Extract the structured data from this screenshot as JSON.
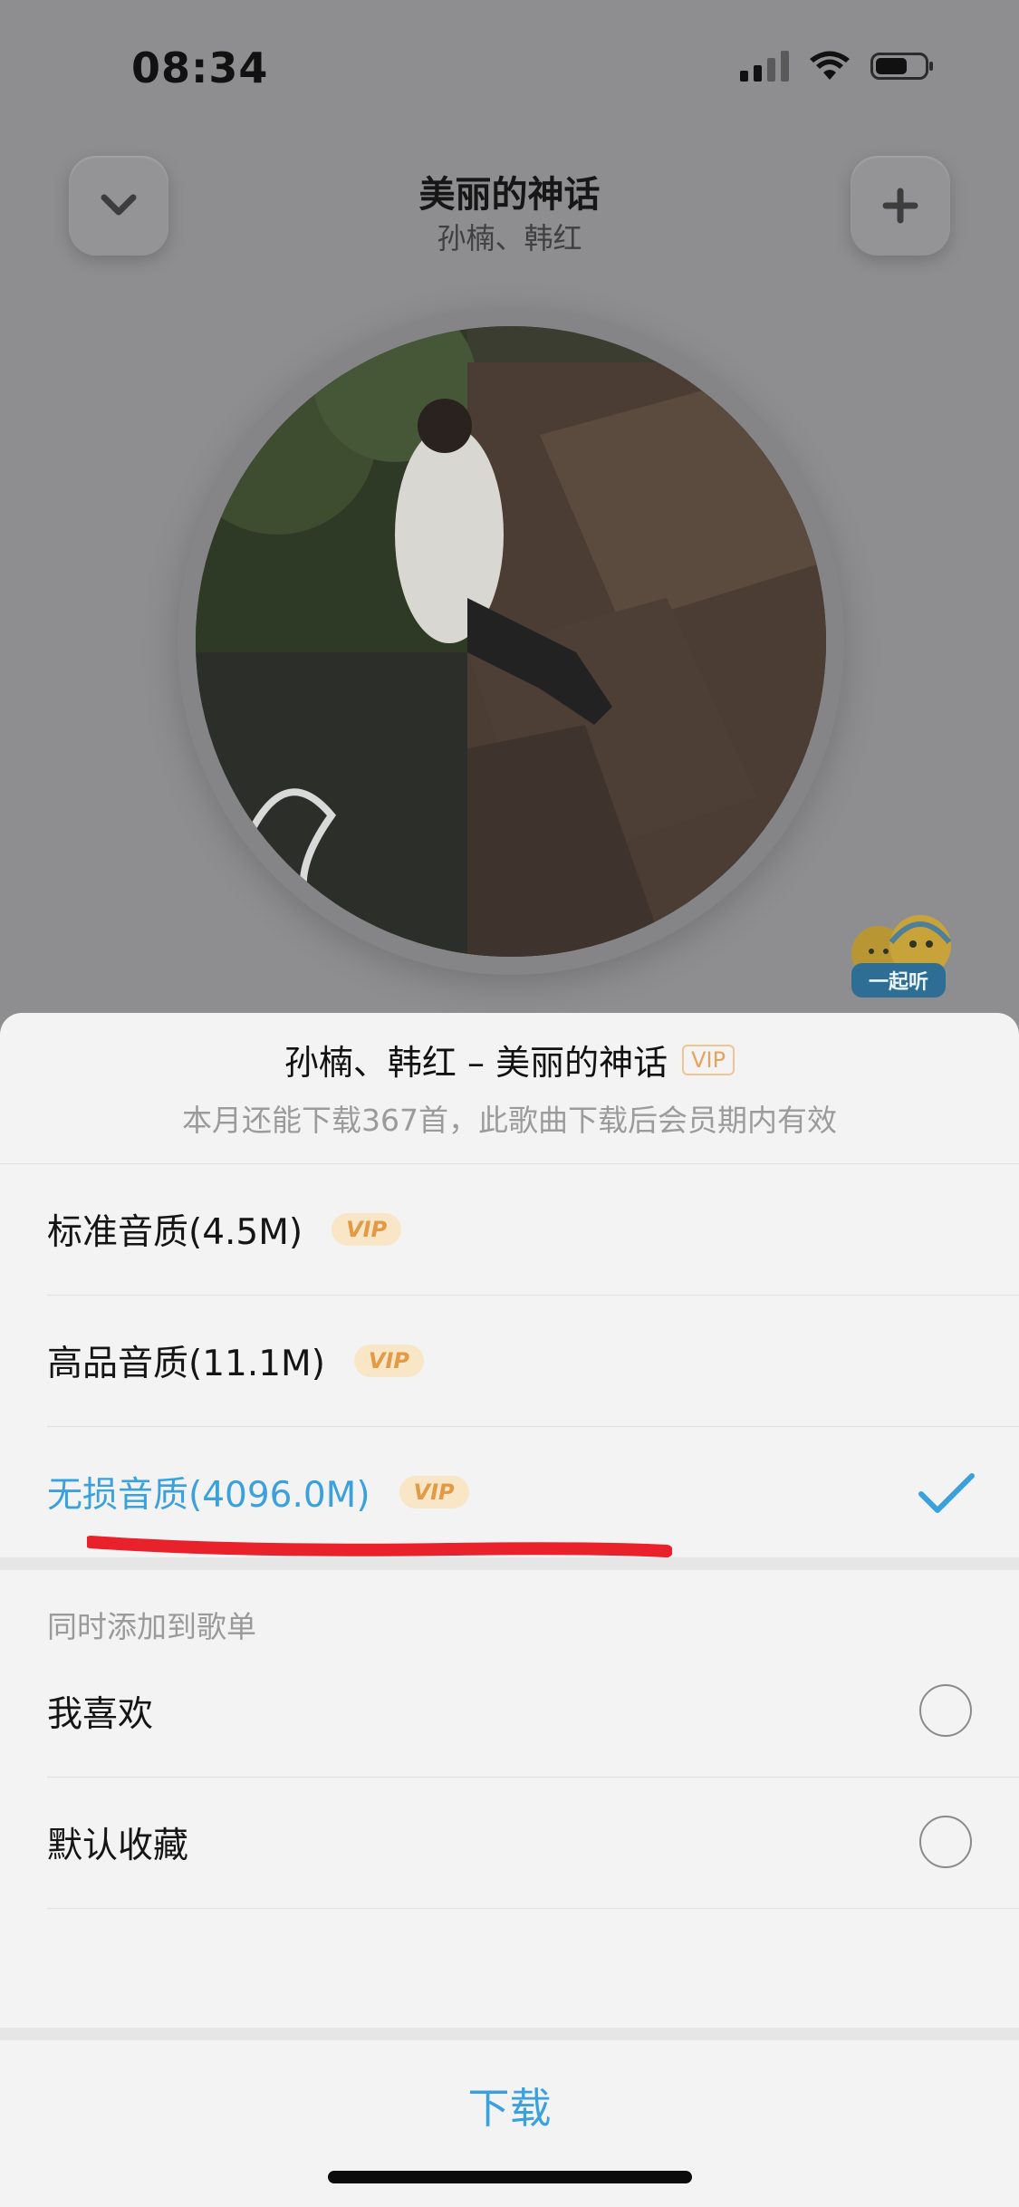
{
  "status_bar": {
    "time": "08:34"
  },
  "player": {
    "song_title": "美丽的神话",
    "artist": "孙楠、韩红",
    "collapse_icon": "chevron-down-icon",
    "add_icon": "plus-icon",
    "together_label": "一起听"
  },
  "sheet": {
    "title": "孙楠、韩红 – 美丽的神话",
    "title_badge": "VIP",
    "subtitle": "本月还能下载367首，此歌曲下载后会员期内有效",
    "qualities": [
      {
        "label": "标准音质(4.5M)",
        "badge": "VIP",
        "selected": false
      },
      {
        "label": "高品音质(11.1M)",
        "badge": "VIP",
        "selected": false
      },
      {
        "label": "无损音质(4096.0M)",
        "badge": "VIP",
        "selected": true
      }
    ],
    "playlist_section_label": "同时添加到歌单",
    "playlists": [
      {
        "label": "我喜欢",
        "checked": false
      },
      {
        "label": "默认收藏",
        "checked": false
      }
    ],
    "download_label": "下载"
  },
  "colors": {
    "accent": "#3aa1dd",
    "vip": "#e29a44",
    "annotation": "#e8212b"
  }
}
